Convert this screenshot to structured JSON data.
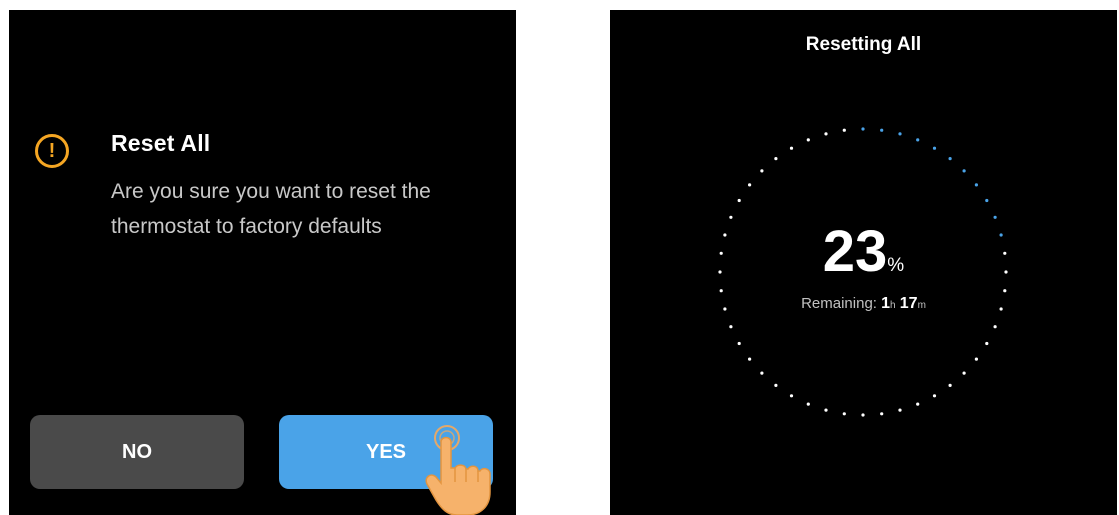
{
  "confirm_dialog": {
    "icon": "exclamation-circle-icon",
    "icon_color": "#f5a623",
    "title": "Reset All",
    "message": "Are you sure you want to reset the thermostat to factory defaults",
    "no_label": "NO",
    "yes_label": "YES",
    "no_color": "#4a4a4a",
    "yes_color": "#4aa3e8",
    "pointer": "hand-pointer-icon"
  },
  "progress_screen": {
    "title": "Resetting All",
    "percent": "23",
    "percent_unit": "%",
    "progress_fraction": 0.23,
    "remaining_label": "Remaining:",
    "remaining_hours": "1",
    "hours_unit": "h",
    "remaining_minutes": "17",
    "minutes_unit": "m",
    "dot_color_done": "#4aa3e8",
    "dot_color_pending": "#ffffff"
  }
}
